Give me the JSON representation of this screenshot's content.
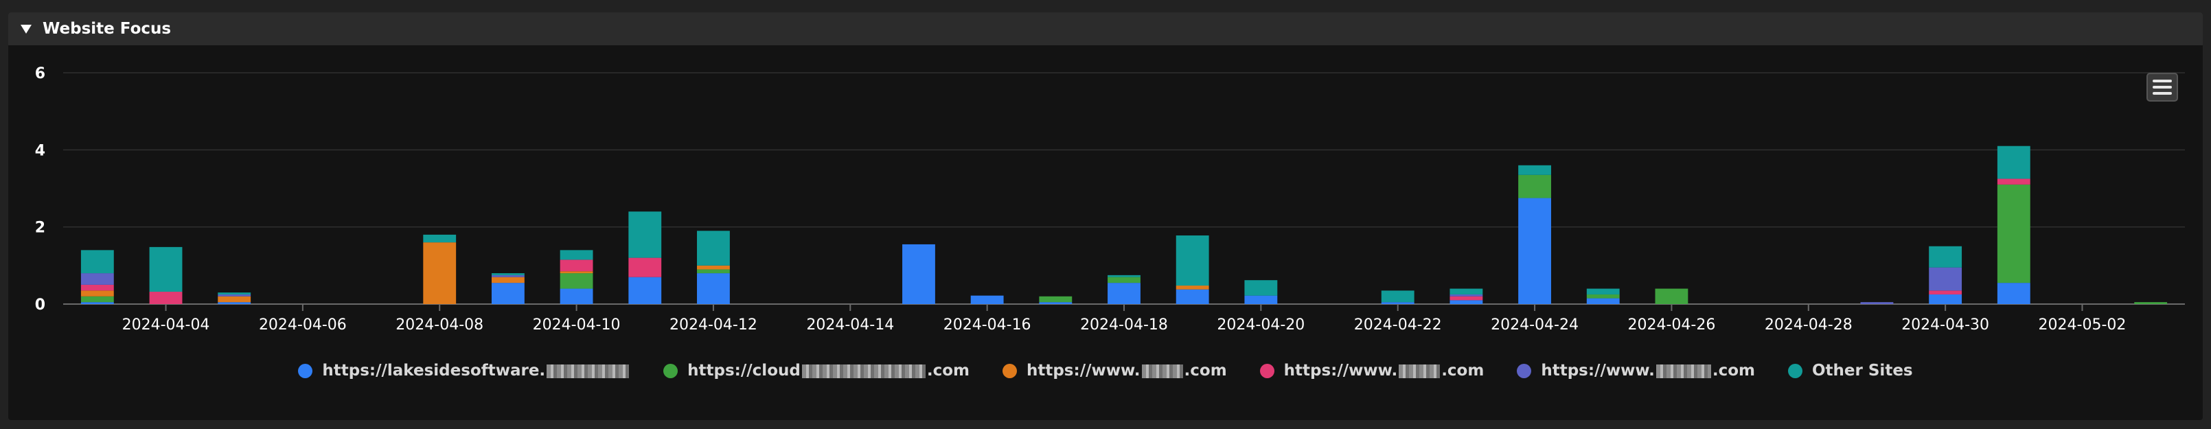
{
  "panel": {
    "title": "Website Focus"
  },
  "colors": {
    "background": "#131313",
    "grid": "#2f2f2f",
    "axis_text": "#ffffff"
  },
  "chart_data": {
    "type": "bar",
    "stacked": true,
    "title": "",
    "xlabel": "",
    "ylabel": "",
    "ylim": [
      0,
      6
    ],
    "yticks": [
      0,
      2,
      4,
      6
    ],
    "categories": [
      "2024-04-03",
      "2024-04-04",
      "2024-04-05",
      "2024-04-06",
      "2024-04-07",
      "2024-04-08",
      "2024-04-09",
      "2024-04-10",
      "2024-04-11",
      "2024-04-12",
      "2024-04-13",
      "2024-04-14",
      "2024-04-15",
      "2024-04-16",
      "2024-04-17",
      "2024-04-18",
      "2024-04-19",
      "2024-04-20",
      "2024-04-21",
      "2024-04-22",
      "2024-04-23",
      "2024-04-24",
      "2024-04-25",
      "2024-04-26",
      "2024-04-27",
      "2024-04-28",
      "2024-04-29",
      "2024-04-30",
      "2024-05-01",
      "2024-05-02",
      "2024-05-03"
    ],
    "xtick_labels": [
      "2024-04-04",
      "2024-04-06",
      "2024-04-08",
      "2024-04-10",
      "2024-04-12",
      "2024-04-14",
      "2024-04-16",
      "2024-04-18",
      "2024-04-20",
      "2024-04-22",
      "2024-04-24",
      "2024-04-26",
      "2024-04-28",
      "2024-04-30",
      "2024-05-02"
    ],
    "grid": true,
    "legend_position": "bottom",
    "series": [
      {
        "name_prefix": "https://lakesidesoftware.",
        "name_suffix": "",
        "redact_width": 120,
        "color": "#2f7ef5",
        "values": [
          0.05,
          0,
          0.05,
          0,
          0,
          0,
          0.55,
          0.4,
          0.7,
          0.8,
          0,
          0,
          1.55,
          0.22,
          0.05,
          0.55,
          0.38,
          0.22,
          0,
          0.05,
          0.1,
          2.75,
          0.15,
          0,
          0,
          0,
          0,
          0.25,
          0.55,
          0,
          0
        ]
      },
      {
        "name_prefix": "https://cloud",
        "name_suffix": ".com",
        "redact_width": 180,
        "color": "#3fa33f",
        "values": [
          0.15,
          0,
          0,
          0,
          0,
          0,
          0,
          0.4,
          0,
          0.1,
          0,
          0,
          0,
          0,
          0.15,
          0.15,
          0,
          0,
          0,
          0,
          0,
          0.6,
          0.1,
          0.4,
          0,
          0,
          0,
          0,
          2.55,
          0,
          0.05
        ]
      },
      {
        "name_prefix": "https://www.",
        "name_suffix": ".com",
        "redact_width": 60,
        "color": "#e07b1c",
        "values": [
          0.15,
          0,
          0.15,
          0,
          0,
          1.6,
          0.15,
          0.05,
          0,
          0.1,
          0,
          0,
          0,
          0,
          0,
          0,
          0.1,
          0,
          0,
          0,
          0,
          0,
          0,
          0,
          0,
          0,
          0,
          0,
          0,
          0,
          0
        ]
      },
      {
        "name_prefix": "https://www.",
        "name_suffix": ".com",
        "redact_width": 60,
        "color": "#e23a73",
        "values": [
          0.15,
          0.32,
          0,
          0,
          0,
          0,
          0,
          0.3,
          0.5,
          0,
          0,
          0,
          0,
          0,
          0,
          0,
          0,
          0,
          0,
          0,
          0.1,
          0,
          0,
          0,
          0,
          0,
          0,
          0.1,
          0.15,
          0,
          0
        ]
      },
      {
        "name_prefix": "https://www.",
        "name_suffix": ".com",
        "redact_width": 80,
        "color": "#5d63c6",
        "values": [
          0.3,
          0,
          0.05,
          0,
          0,
          0,
          0.05,
          0,
          0,
          0,
          0,
          0,
          0,
          0,
          0,
          0,
          0,
          0,
          0,
          0,
          0.05,
          0,
          0,
          0,
          0,
          0,
          0.05,
          0.6,
          0,
          0,
          0
        ]
      },
      {
        "name_prefix": "Other Sites",
        "name_suffix": "",
        "redact_width": 0,
        "color": "#119c98",
        "values": [
          0.6,
          1.16,
          0.05,
          0,
          0,
          0.2,
          0.05,
          0.25,
          1.2,
          0.9,
          0,
          0,
          0,
          0,
          0,
          0.05,
          1.3,
          0.4,
          0,
          0.3,
          0.15,
          0.25,
          0.15,
          0,
          0,
          0,
          0,
          0.55,
          0.85,
          0,
          0
        ]
      }
    ]
  }
}
